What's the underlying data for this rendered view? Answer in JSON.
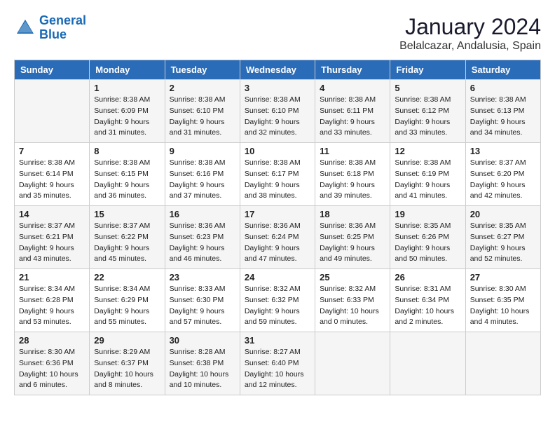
{
  "logo": {
    "line1": "General",
    "line2": "Blue"
  },
  "title": "January 2024",
  "location": "Belalcazar, Andalusia, Spain",
  "days_of_week": [
    "Sunday",
    "Monday",
    "Tuesday",
    "Wednesday",
    "Thursday",
    "Friday",
    "Saturday"
  ],
  "weeks": [
    [
      {
        "day": "",
        "sunrise": "",
        "sunset": "",
        "daylight": ""
      },
      {
        "day": "1",
        "sunrise": "Sunrise: 8:38 AM",
        "sunset": "Sunset: 6:09 PM",
        "daylight": "Daylight: 9 hours and 31 minutes."
      },
      {
        "day": "2",
        "sunrise": "Sunrise: 8:38 AM",
        "sunset": "Sunset: 6:10 PM",
        "daylight": "Daylight: 9 hours and 31 minutes."
      },
      {
        "day": "3",
        "sunrise": "Sunrise: 8:38 AM",
        "sunset": "Sunset: 6:10 PM",
        "daylight": "Daylight: 9 hours and 32 minutes."
      },
      {
        "day": "4",
        "sunrise": "Sunrise: 8:38 AM",
        "sunset": "Sunset: 6:11 PM",
        "daylight": "Daylight: 9 hours and 33 minutes."
      },
      {
        "day": "5",
        "sunrise": "Sunrise: 8:38 AM",
        "sunset": "Sunset: 6:12 PM",
        "daylight": "Daylight: 9 hours and 33 minutes."
      },
      {
        "day": "6",
        "sunrise": "Sunrise: 8:38 AM",
        "sunset": "Sunset: 6:13 PM",
        "daylight": "Daylight: 9 hours and 34 minutes."
      }
    ],
    [
      {
        "day": "7",
        "sunrise": "Sunrise: 8:38 AM",
        "sunset": "Sunset: 6:14 PM",
        "daylight": "Daylight: 9 hours and 35 minutes."
      },
      {
        "day": "8",
        "sunrise": "Sunrise: 8:38 AM",
        "sunset": "Sunset: 6:15 PM",
        "daylight": "Daylight: 9 hours and 36 minutes."
      },
      {
        "day": "9",
        "sunrise": "Sunrise: 8:38 AM",
        "sunset": "Sunset: 6:16 PM",
        "daylight": "Daylight: 9 hours and 37 minutes."
      },
      {
        "day": "10",
        "sunrise": "Sunrise: 8:38 AM",
        "sunset": "Sunset: 6:17 PM",
        "daylight": "Daylight: 9 hours and 38 minutes."
      },
      {
        "day": "11",
        "sunrise": "Sunrise: 8:38 AM",
        "sunset": "Sunset: 6:18 PM",
        "daylight": "Daylight: 9 hours and 39 minutes."
      },
      {
        "day": "12",
        "sunrise": "Sunrise: 8:38 AM",
        "sunset": "Sunset: 6:19 PM",
        "daylight": "Daylight: 9 hours and 41 minutes."
      },
      {
        "day": "13",
        "sunrise": "Sunrise: 8:37 AM",
        "sunset": "Sunset: 6:20 PM",
        "daylight": "Daylight: 9 hours and 42 minutes."
      }
    ],
    [
      {
        "day": "14",
        "sunrise": "Sunrise: 8:37 AM",
        "sunset": "Sunset: 6:21 PM",
        "daylight": "Daylight: 9 hours and 43 minutes."
      },
      {
        "day": "15",
        "sunrise": "Sunrise: 8:37 AM",
        "sunset": "Sunset: 6:22 PM",
        "daylight": "Daylight: 9 hours and 45 minutes."
      },
      {
        "day": "16",
        "sunrise": "Sunrise: 8:36 AM",
        "sunset": "Sunset: 6:23 PM",
        "daylight": "Daylight: 9 hours and 46 minutes."
      },
      {
        "day": "17",
        "sunrise": "Sunrise: 8:36 AM",
        "sunset": "Sunset: 6:24 PM",
        "daylight": "Daylight: 9 hours and 47 minutes."
      },
      {
        "day": "18",
        "sunrise": "Sunrise: 8:36 AM",
        "sunset": "Sunset: 6:25 PM",
        "daylight": "Daylight: 9 hours and 49 minutes."
      },
      {
        "day": "19",
        "sunrise": "Sunrise: 8:35 AM",
        "sunset": "Sunset: 6:26 PM",
        "daylight": "Daylight: 9 hours and 50 minutes."
      },
      {
        "day": "20",
        "sunrise": "Sunrise: 8:35 AM",
        "sunset": "Sunset: 6:27 PM",
        "daylight": "Daylight: 9 hours and 52 minutes."
      }
    ],
    [
      {
        "day": "21",
        "sunrise": "Sunrise: 8:34 AM",
        "sunset": "Sunset: 6:28 PM",
        "daylight": "Daylight: 9 hours and 53 minutes."
      },
      {
        "day": "22",
        "sunrise": "Sunrise: 8:34 AM",
        "sunset": "Sunset: 6:29 PM",
        "daylight": "Daylight: 9 hours and 55 minutes."
      },
      {
        "day": "23",
        "sunrise": "Sunrise: 8:33 AM",
        "sunset": "Sunset: 6:30 PM",
        "daylight": "Daylight: 9 hours and 57 minutes."
      },
      {
        "day": "24",
        "sunrise": "Sunrise: 8:32 AM",
        "sunset": "Sunset: 6:32 PM",
        "daylight": "Daylight: 9 hours and 59 minutes."
      },
      {
        "day": "25",
        "sunrise": "Sunrise: 8:32 AM",
        "sunset": "Sunset: 6:33 PM",
        "daylight": "Daylight: 10 hours and 0 minutes."
      },
      {
        "day": "26",
        "sunrise": "Sunrise: 8:31 AM",
        "sunset": "Sunset: 6:34 PM",
        "daylight": "Daylight: 10 hours and 2 minutes."
      },
      {
        "day": "27",
        "sunrise": "Sunrise: 8:30 AM",
        "sunset": "Sunset: 6:35 PM",
        "daylight": "Daylight: 10 hours and 4 minutes."
      }
    ],
    [
      {
        "day": "28",
        "sunrise": "Sunrise: 8:30 AM",
        "sunset": "Sunset: 6:36 PM",
        "daylight": "Daylight: 10 hours and 6 minutes."
      },
      {
        "day": "29",
        "sunrise": "Sunrise: 8:29 AM",
        "sunset": "Sunset: 6:37 PM",
        "daylight": "Daylight: 10 hours and 8 minutes."
      },
      {
        "day": "30",
        "sunrise": "Sunrise: 8:28 AM",
        "sunset": "Sunset: 6:38 PM",
        "daylight": "Daylight: 10 hours and 10 minutes."
      },
      {
        "day": "31",
        "sunrise": "Sunrise: 8:27 AM",
        "sunset": "Sunset: 6:40 PM",
        "daylight": "Daylight: 10 hours and 12 minutes."
      },
      {
        "day": "",
        "sunrise": "",
        "sunset": "",
        "daylight": ""
      },
      {
        "day": "",
        "sunrise": "",
        "sunset": "",
        "daylight": ""
      },
      {
        "day": "",
        "sunrise": "",
        "sunset": "",
        "daylight": ""
      }
    ]
  ]
}
